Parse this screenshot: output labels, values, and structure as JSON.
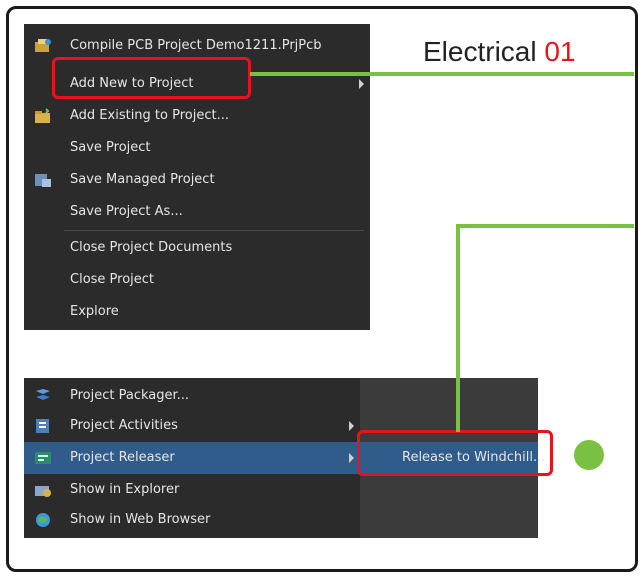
{
  "heading": {
    "text": "Electrical",
    "number": "01"
  },
  "menu_top": {
    "items": [
      {
        "label": "Compile PCB Project Demo1211.PrjPcb",
        "icon": "compile-icon"
      },
      {
        "label": "Add New to Project",
        "submenu": true
      },
      {
        "label": "Add Existing to Project...",
        "icon": "folder-add-icon"
      },
      {
        "label": "Save Project"
      },
      {
        "label": "Save Managed Project",
        "icon": "managed-project-icon"
      },
      {
        "label": "Save Project As..."
      },
      {
        "label": "Close Project Documents"
      },
      {
        "label": "Close Project"
      },
      {
        "label": "Explore"
      }
    ]
  },
  "menu_bottom": {
    "items": [
      {
        "label": "Project Packager...",
        "icon": "packager-icon"
      },
      {
        "label": "Project Activities",
        "icon": "activities-icon",
        "submenu": true
      },
      {
        "label": "Project Releaser",
        "icon": "releaser-icon",
        "submenu": true
      },
      {
        "label": "Show in Explorer",
        "icon": "explorer-icon"
      },
      {
        "label": "Show in Web Browser",
        "icon": "globe-icon"
      }
    ],
    "submenu_item": "Release to Windchill..."
  },
  "colors": {
    "accent_red": "#e8141c",
    "accent_green": "#7ac143",
    "menu_bg": "#2b2b2b",
    "selection": "#2f5c8a"
  }
}
